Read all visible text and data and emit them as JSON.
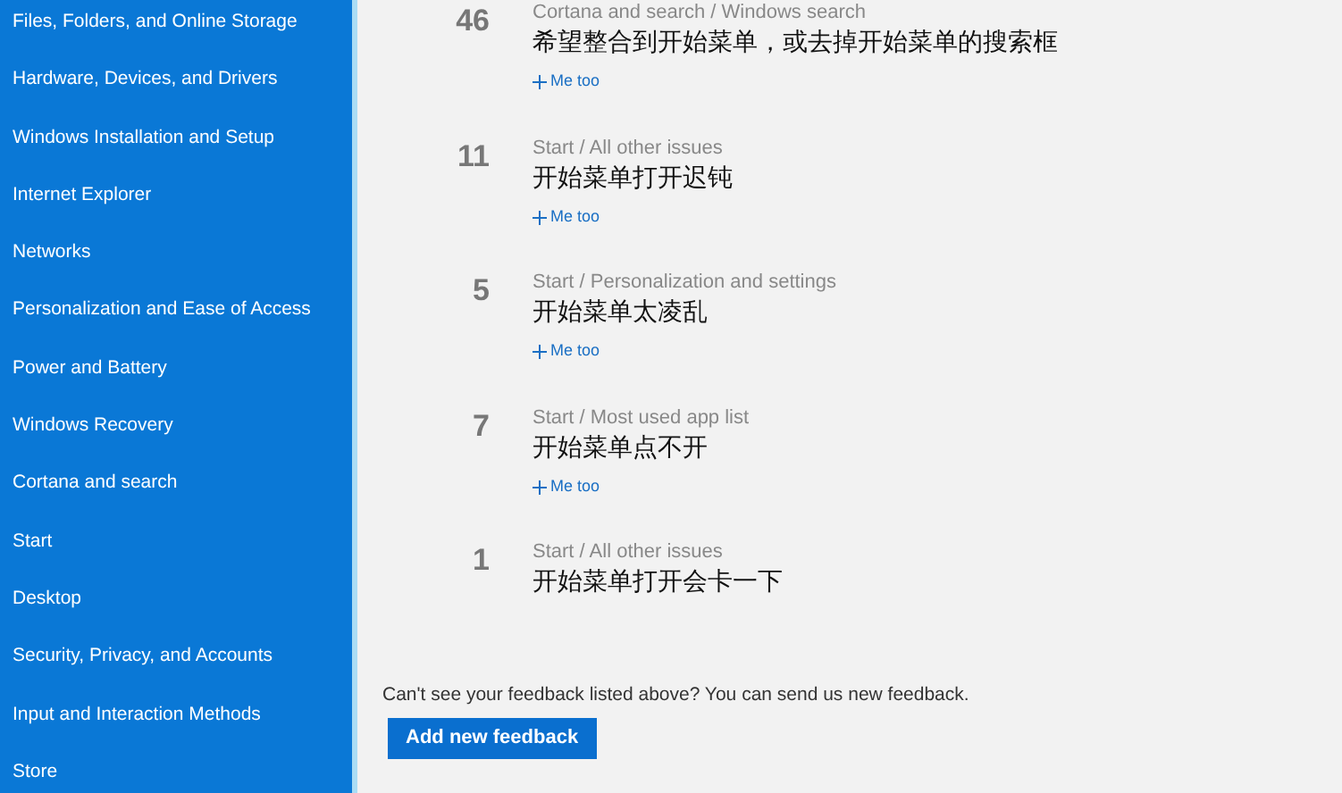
{
  "sidebar": {
    "items": [
      {
        "label": "Files, Folders, and Online Storage"
      },
      {
        "label": "Hardware, Devices, and Drivers"
      },
      {
        "label": "Windows Installation and Setup"
      },
      {
        "label": "Internet Explorer"
      },
      {
        "label": "Networks"
      },
      {
        "label": "Personalization and Ease of Access"
      },
      {
        "label": "Power and Battery"
      },
      {
        "label": "Windows Recovery"
      },
      {
        "label": "Cortana and search"
      },
      {
        "label": "Start"
      },
      {
        "label": "Desktop"
      },
      {
        "label": "Security, Privacy, and Accounts"
      },
      {
        "label": "Input and Interaction Methods"
      },
      {
        "label": "Store"
      }
    ]
  },
  "feedback": [
    {
      "votes": "46",
      "category": "Cortana and search / Windows search",
      "title": "希望整合到开始菜单，或去掉开始菜单的搜索框",
      "action": "Me too"
    },
    {
      "votes": "11",
      "category": "Start / All other issues",
      "title": "开始菜单打开迟钝",
      "action": "Me too"
    },
    {
      "votes": "5",
      "category": "Start / Personalization and settings",
      "title": "开始菜单太凌乱",
      "action": "Me too"
    },
    {
      "votes": "7",
      "category": "Start / Most used app list",
      "title": "开始菜单点不开",
      "action": "Me too"
    },
    {
      "votes": "1",
      "category": "Start / All other issues",
      "title": "开始菜单打开会卡一下"
    }
  ],
  "footer": {
    "text": "Can't see your feedback listed above? You can send us new feedback.",
    "button": "Add new feedback"
  }
}
